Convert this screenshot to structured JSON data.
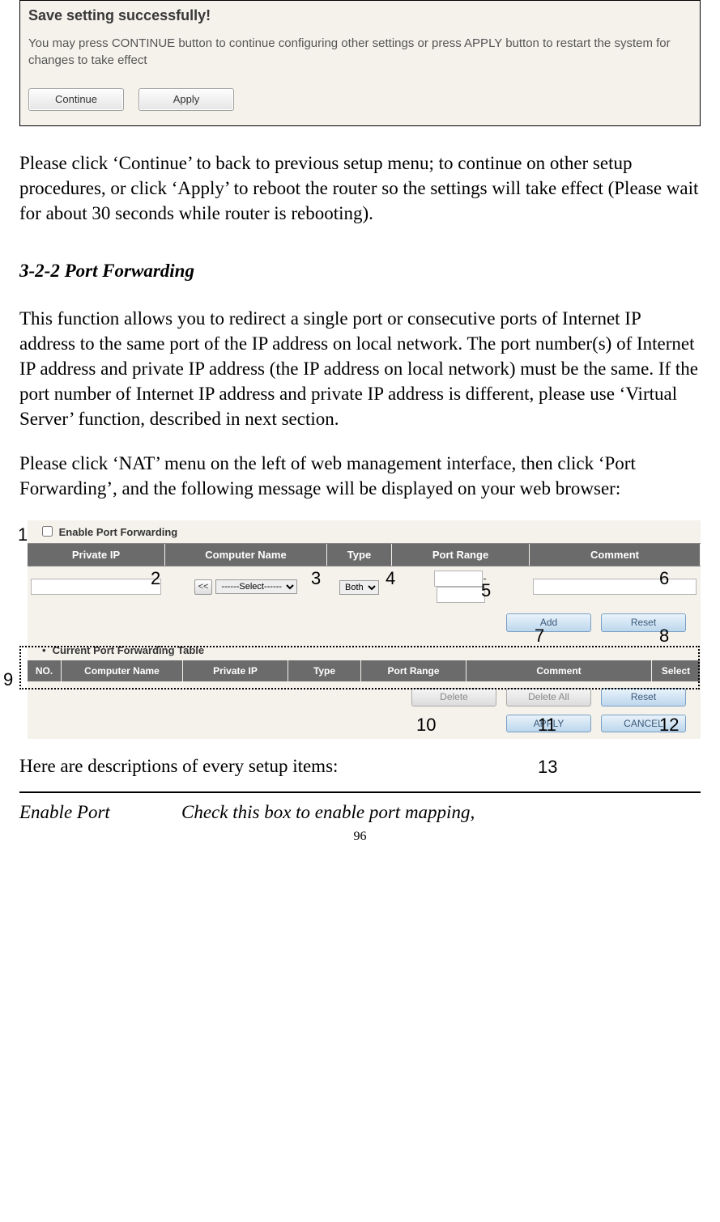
{
  "dialog": {
    "title": "Save setting successfully!",
    "message": "You may press CONTINUE button to continue configuring other settings or press APPLY button to restart the system for changes to take effect",
    "continue_label": "Continue",
    "apply_label": "Apply"
  },
  "body": {
    "p1": "Please click ‘Continue’ to back to previous setup menu; to continue on other setup procedures, or click ‘Apply’ to reboot the router so the settings will take effect (Please wait for about 30 seconds while router is rebooting).",
    "h1": "3-2-2 Port Forwarding",
    "p2": "This function allows you to redirect a single port or consecutive ports of Internet IP address to the same port of the IP address on local network. The port number(s) of Internet IP address and private IP address (the IP address on local network) must be the same. If the port number of Internet IP address and private IP address is different, please use ‘Virtual Server’ function, described in next section.",
    "p3": "Please click ‘NAT’ menu on the left of web management interface, then click ‘Port Forwarding’, and the following message will be displayed on your web browser:",
    "desc": "Here are descriptions of every setup items:",
    "def_term": "Enable Port",
    "def_body": "Check this box to enable port mapping,"
  },
  "pf": {
    "enable_label": "Enable Port Forwarding",
    "head": {
      "priv": "Private IP",
      "comp": "Computer Name",
      "type": "Type",
      "range": "Port Range",
      "comment": "Comment"
    },
    "row": {
      "ll": "<<",
      "select_placeholder": "------Select------",
      "type_val": "Both"
    },
    "btn_add": "Add",
    "btn_reset": "Reset",
    "sub_title": "Current Port Forwarding Table",
    "head2": {
      "no": "NO.",
      "comp": "Computer Name",
      "priv": "Private IP",
      "type": "Type",
      "range": "Port Range",
      "comment": "Comment",
      "sel": "Select"
    },
    "btn_delete": "Delete",
    "btn_delete_all": "Delete All",
    "btn_reset2": "Reset",
    "btn_apply": "APPLY",
    "btn_cancel": "CANCEL"
  },
  "callouts": {
    "c1": "1",
    "c2": "2",
    "c3": "3",
    "c4": "4",
    "c5": "5",
    "c6": "6",
    "c7": "7",
    "c8": "8",
    "c9": "9",
    "c10": "10",
    "c11": "11",
    "c12": "12",
    "c13": "13"
  },
  "page_num": "96"
}
